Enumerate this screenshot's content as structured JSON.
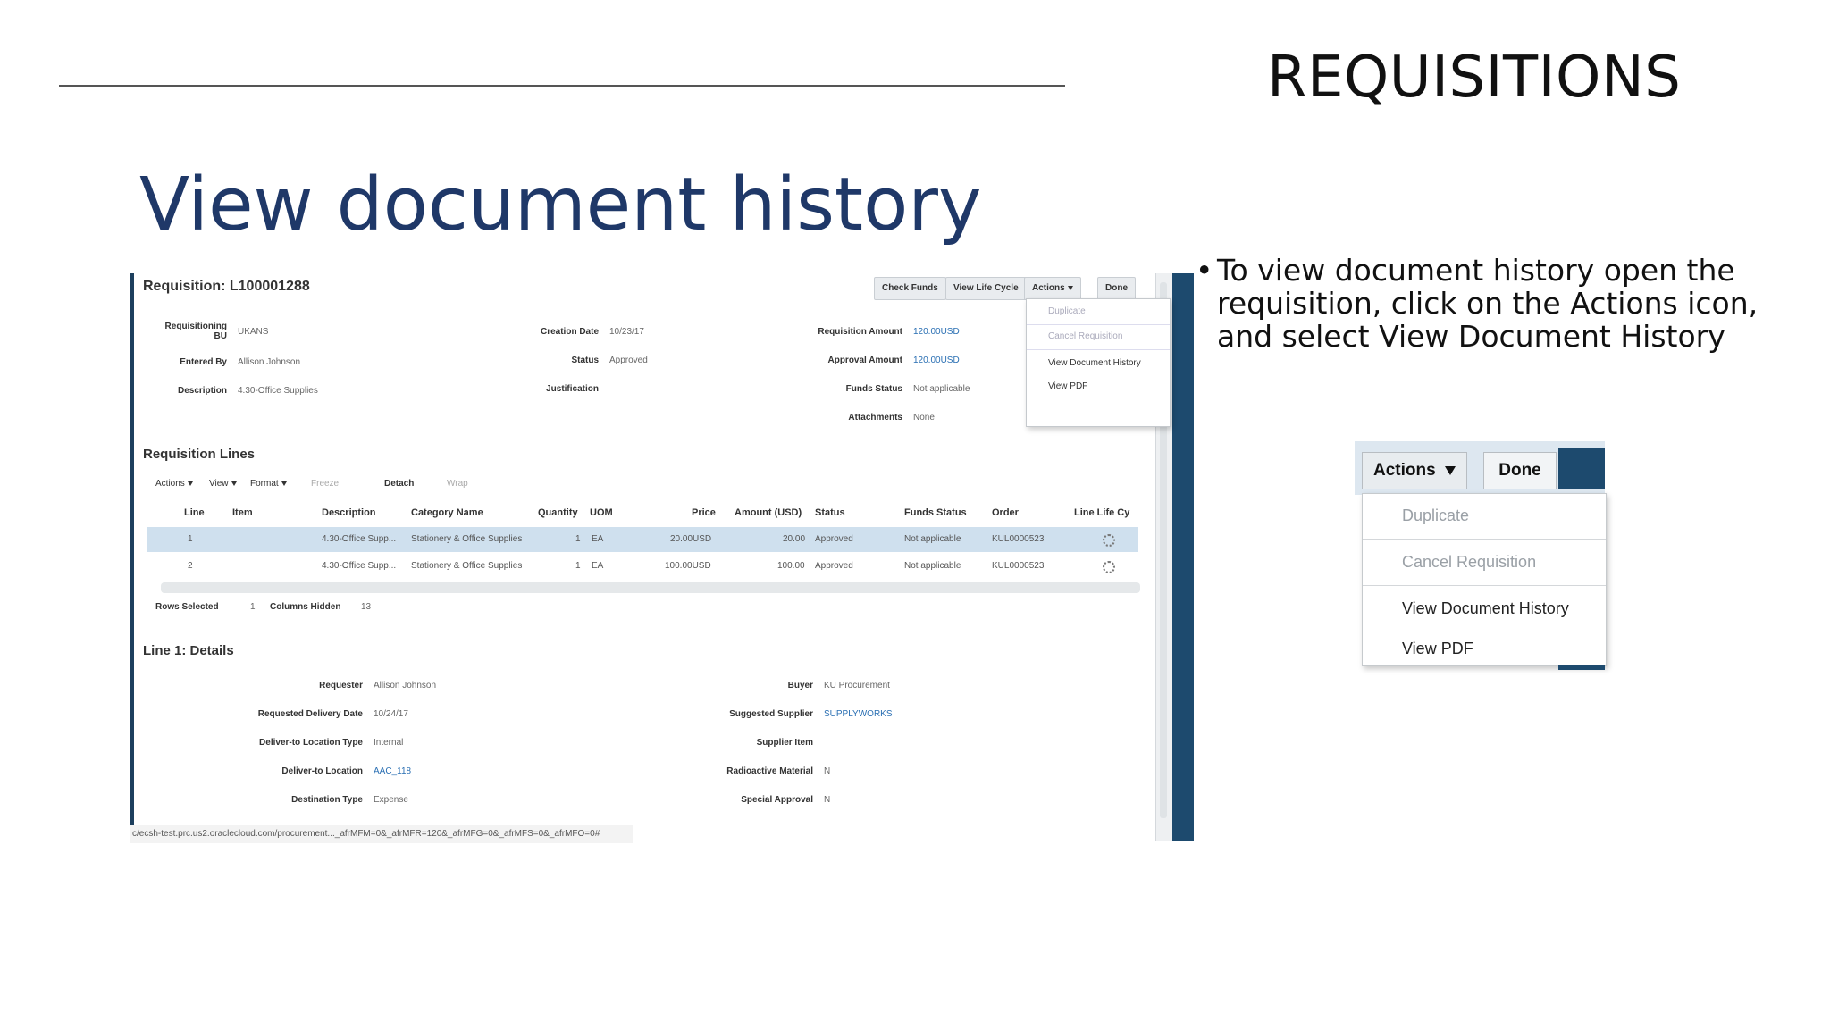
{
  "slide": {
    "section": "REQUISITIONS",
    "title": "View document history",
    "bullet": "To view document history open the requisition, click on the Actions icon, and select View Document History"
  },
  "screenshot": {
    "header": "Requisition: L100001288",
    "buttons": [
      "Check Funds",
      "View Life Cycle",
      "Actions",
      "Done"
    ],
    "actions_menu": [
      "Duplicate",
      "Cancel Requisition",
      "View Document History",
      "View PDF"
    ],
    "fields": {
      "req_bu_label": "Requisitioning BU",
      "req_bu_value": "UKANS",
      "entered_by_label": "Entered By",
      "entered_by_value": "Allison Johnson",
      "description_label": "Description",
      "description_value": "4.30-Office Supplies",
      "creation_date_label": "Creation Date",
      "creation_date_value": "10/23/17",
      "status_label": "Status",
      "status_value": "Approved",
      "justification_label": "Justification",
      "req_amount_label": "Requisition Amount",
      "req_amount_value": "120.00USD",
      "approval_amount_label": "Approval Amount",
      "approval_amount_value": "120.00USD",
      "funds_status_label": "Funds Status",
      "funds_status_value": "Not applicable",
      "attachments_label": "Attachments",
      "attachments_value": "None"
    },
    "lines_header": "Requisition Lines",
    "toolbar": [
      "Actions",
      "View",
      "Format",
      "Freeze",
      "Detach",
      "Wrap"
    ],
    "columns": [
      "Line",
      "Item",
      "Description",
      "Category Name",
      "Quantity",
      "UOM",
      "Price",
      "Amount (USD)",
      "Status",
      "Funds Status",
      "Order",
      "Line Life Cy"
    ],
    "rows": [
      {
        "line": "1",
        "description": "4.30-Office Supp...",
        "category": "Stationery & Office Supplies",
        "quantity": "1",
        "uom": "EA",
        "price": "20.00USD",
        "amount": "20.00",
        "status": "Approved",
        "funds": "Not applicable",
        "order": "KUL0000523"
      },
      {
        "line": "2",
        "description": "4.30-Office Supp...",
        "category": "Stationery & Office Supplies",
        "quantity": "1",
        "uom": "EA",
        "price": "100.00USD",
        "amount": "100.00",
        "status": "Approved",
        "funds": "Not applicable",
        "order": "KUL0000523"
      }
    ],
    "rows_selected_label": "Rows Selected",
    "rows_selected_value": "1",
    "columns_hidden_label": "Columns Hidden",
    "columns_hidden_value": "13",
    "details_header": "Line 1: Details",
    "details": {
      "requester_label": "Requester",
      "requester_value": "Allison Johnson",
      "delivery_date_label": "Requested Delivery Date",
      "delivery_date_value": "10/24/17",
      "deliver_type_label": "Deliver-to Location Type",
      "deliver_type_value": "Internal",
      "deliver_loc_label": "Deliver-to Location",
      "deliver_loc_value": "AAC_118",
      "dest_type_label": "Destination Type",
      "dest_type_value": "Expense",
      "buyer_label": "Buyer",
      "buyer_value": "KU Procurement",
      "supplier_label": "Suggested Supplier",
      "supplier_value": "SUPPLYWORKS",
      "supplier_item_label": "Supplier Item",
      "radioactive_label": "Radioactive Material",
      "radioactive_value": "N",
      "special_label": "Special Approval",
      "special_value": "N"
    },
    "status_url": "c/ecsh-test.prc.us2.oraclecloud.com/procurement..._afrMFM=0&_afrMFR=120&_afrMFG=0&_afrMFS=0&_afrMFO=0#"
  },
  "zoom": {
    "actions": "Actions",
    "done": "Done",
    "menu": [
      "Duplicate",
      "Cancel Requisition",
      "View Document History",
      "View PDF"
    ]
  }
}
